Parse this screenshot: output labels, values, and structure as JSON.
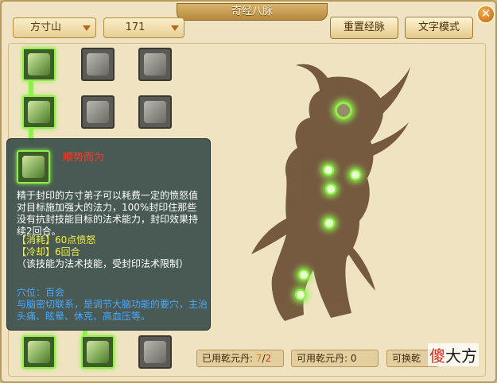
{
  "window": {
    "title": "奇经八脉",
    "close_icon": "close-icon"
  },
  "header": {
    "school_select": "方寸山",
    "level_select": "171",
    "reset_button": "重置经脉",
    "text_mode_button": "文字模式"
  },
  "tooltip": {
    "skill_name": "顺势而为",
    "description": "精于封印的方寸弟子可以耗费一定的愤怒值对目标施加强大的法力，100%封印住那些没有抗封技能目标的法术能力，封印效果持续2回合。",
    "cost": "【消耗】60点愤怒",
    "cooldown": "【冷却】6回合",
    "note": "（该技能为法术技能，受封印法术限制）",
    "acupoint_label": "穴位：百会",
    "acupoint_desc": "与脑密切联系，是调节大脑功能的要穴，主治头痛、眩晕、休克、高血压等。"
  },
  "stats": {
    "used_label": "已用乾元丹:",
    "used_value_a": "7",
    "used_value_sep": "/",
    "used_value_b": "2",
    "available_label": "可用乾元丹:",
    "available_value": "0",
    "exchange_label": "可换乾"
  },
  "watermark": {
    "red": "傻",
    "black": "大方"
  },
  "colors": {
    "active_glow": "#8ff04a",
    "tooltip_bg": "#3a4e4a",
    "title_red": "#ff3a2a",
    "highlight_yellow": "#f1ee4a",
    "info_blue": "#4aa8ff"
  }
}
